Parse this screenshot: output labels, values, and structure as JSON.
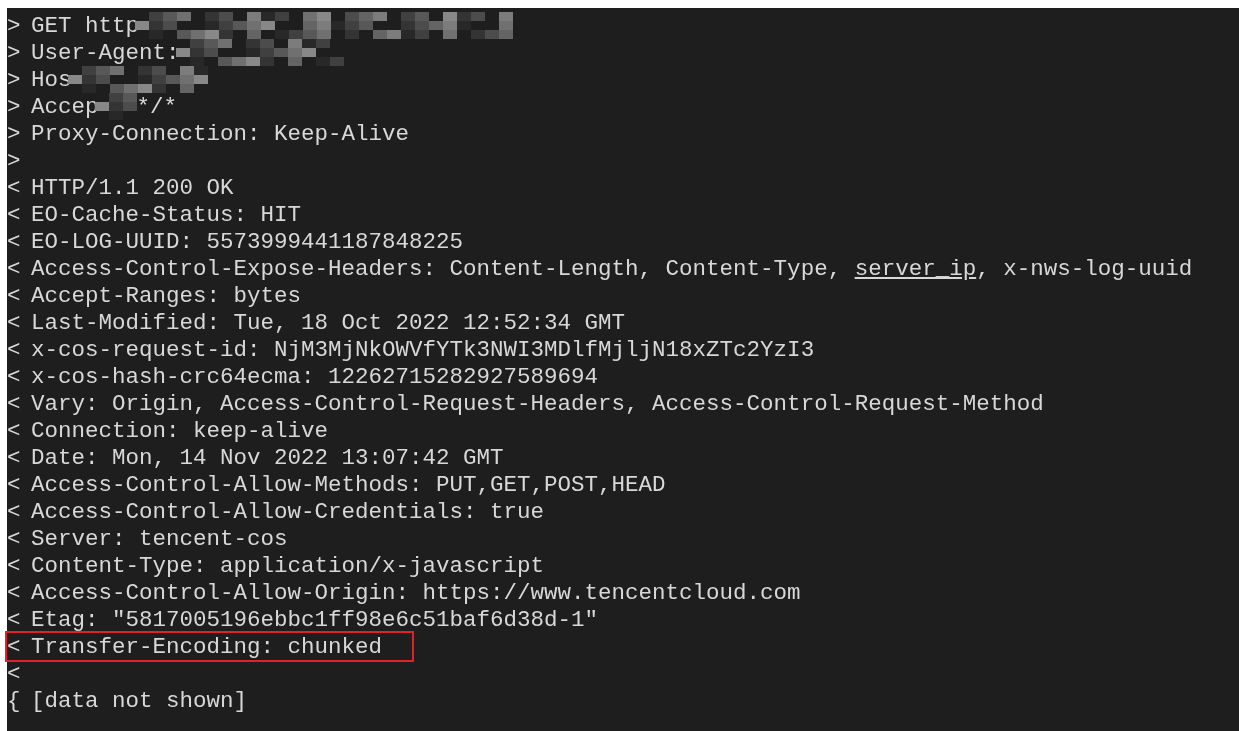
{
  "terminal": {
    "lines": [
      {
        "prefix": ">",
        "highlighted": false,
        "parts": [
          {
            "kind": "text",
            "text": "GET http"
          },
          {
            "kind": "redacted_long"
          }
        ]
      },
      {
        "prefix": ">",
        "highlighted": false,
        "parts": [
          {
            "kind": "text",
            "text": "User-Agent:"
          },
          {
            "kind": "redacted_medium"
          }
        ]
      },
      {
        "prefix": ">",
        "highlighted": false,
        "parts": [
          {
            "kind": "text",
            "text": "Hos"
          },
          {
            "kind": "redacted_short"
          }
        ]
      },
      {
        "prefix": ">",
        "highlighted": false,
        "parts": [
          {
            "kind": "text",
            "text": "Accep"
          },
          {
            "kind": "redacted_tiny"
          },
          {
            "kind": "text",
            "text": "*/*"
          }
        ]
      },
      {
        "prefix": ">",
        "highlighted": false,
        "parts": [
          {
            "kind": "text",
            "text": "Proxy-Connection: Keep-Alive"
          }
        ]
      },
      {
        "prefix": ">",
        "highlighted": false
      },
      {
        "prefix": "<",
        "highlighted": false,
        "parts": [
          {
            "kind": "text",
            "text": "HTTP/1.1 200 OK"
          }
        ]
      },
      {
        "prefix": "<",
        "highlighted": false,
        "parts": [
          {
            "kind": "text",
            "text": "EO-Cache-Status: HIT"
          }
        ]
      },
      {
        "prefix": "<",
        "highlighted": false,
        "parts": [
          {
            "kind": "text",
            "text": "EO-LOG-UUID: 5573999441187848225"
          }
        ]
      },
      {
        "prefix": "<",
        "highlighted": false,
        "parts": [
          {
            "kind": "text",
            "text": "Access-Control-Expose-Headers: Content-Length, Content-Type, "
          },
          {
            "kind": "underlined",
            "text": "server_ip"
          },
          {
            "kind": "text",
            "text": ", x-nws-log-uuid"
          }
        ]
      },
      {
        "prefix": "<",
        "highlighted": false,
        "parts": [
          {
            "kind": "text",
            "text": "Accept-Ranges: bytes"
          }
        ]
      },
      {
        "prefix": "<",
        "highlighted": false,
        "parts": [
          {
            "kind": "text",
            "text": "Last-Modified: Tue, 18 Oct 2022 12:52:34 GMT"
          }
        ]
      },
      {
        "prefix": "<",
        "highlighted": false,
        "parts": [
          {
            "kind": "text",
            "text": "x-cos-request-id: NjM3MjNkOWVfYTk3NWI3MDlfMjljN18xZTc2YzI3"
          }
        ]
      },
      {
        "prefix": "<",
        "highlighted": false,
        "parts": [
          {
            "kind": "text",
            "text": "x-cos-hash-crc64ecma: 12262715282927589694"
          }
        ]
      },
      {
        "prefix": "<",
        "highlighted": false,
        "parts": [
          {
            "kind": "text",
            "text": "Vary: Origin, Access-Control-Request-Headers, Access-Control-Request-Method"
          }
        ]
      },
      {
        "prefix": "<",
        "highlighted": false,
        "parts": [
          {
            "kind": "text",
            "text": "Connection: keep-alive"
          }
        ]
      },
      {
        "prefix": "<",
        "highlighted": false,
        "parts": [
          {
            "kind": "text",
            "text": "Date: Mon, 14 Nov 2022 13:07:42 GMT"
          }
        ]
      },
      {
        "prefix": "<",
        "highlighted": false,
        "parts": [
          {
            "kind": "text",
            "text": "Access-Control-Allow-Methods: PUT,GET,POST,HEAD"
          }
        ]
      },
      {
        "prefix": "<",
        "highlighted": false,
        "parts": [
          {
            "kind": "text",
            "text": "Access-Control-Allow-Credentials: true"
          }
        ]
      },
      {
        "prefix": "<",
        "highlighted": false,
        "parts": [
          {
            "kind": "text",
            "text": "Server: tencent-cos"
          }
        ]
      },
      {
        "prefix": "<",
        "highlighted": false,
        "parts": [
          {
            "kind": "text",
            "text": "Content-Type: application/x-javascript"
          }
        ]
      },
      {
        "prefix": "<",
        "highlighted": false,
        "parts": [
          {
            "kind": "text",
            "text": "Access-Control-Allow-Origin: https://www.tencentcloud.com"
          }
        ]
      },
      {
        "prefix": "<",
        "highlighted": false,
        "parts": [
          {
            "kind": "text",
            "text": "Etag: \"5817005196ebbc1ff98e6c51baf6d38d-1\""
          }
        ]
      },
      {
        "prefix": "<",
        "highlighted": true,
        "parts": [
          {
            "kind": "text",
            "text": "Transfer-Encoding: chunked"
          }
        ]
      },
      {
        "prefix": "<",
        "highlighted": false
      },
      {
        "prefix": "{",
        "highlighted": false,
        "parts": [
          {
            "kind": "text",
            "text": "[data not shown]"
          }
        ]
      }
    ]
  }
}
